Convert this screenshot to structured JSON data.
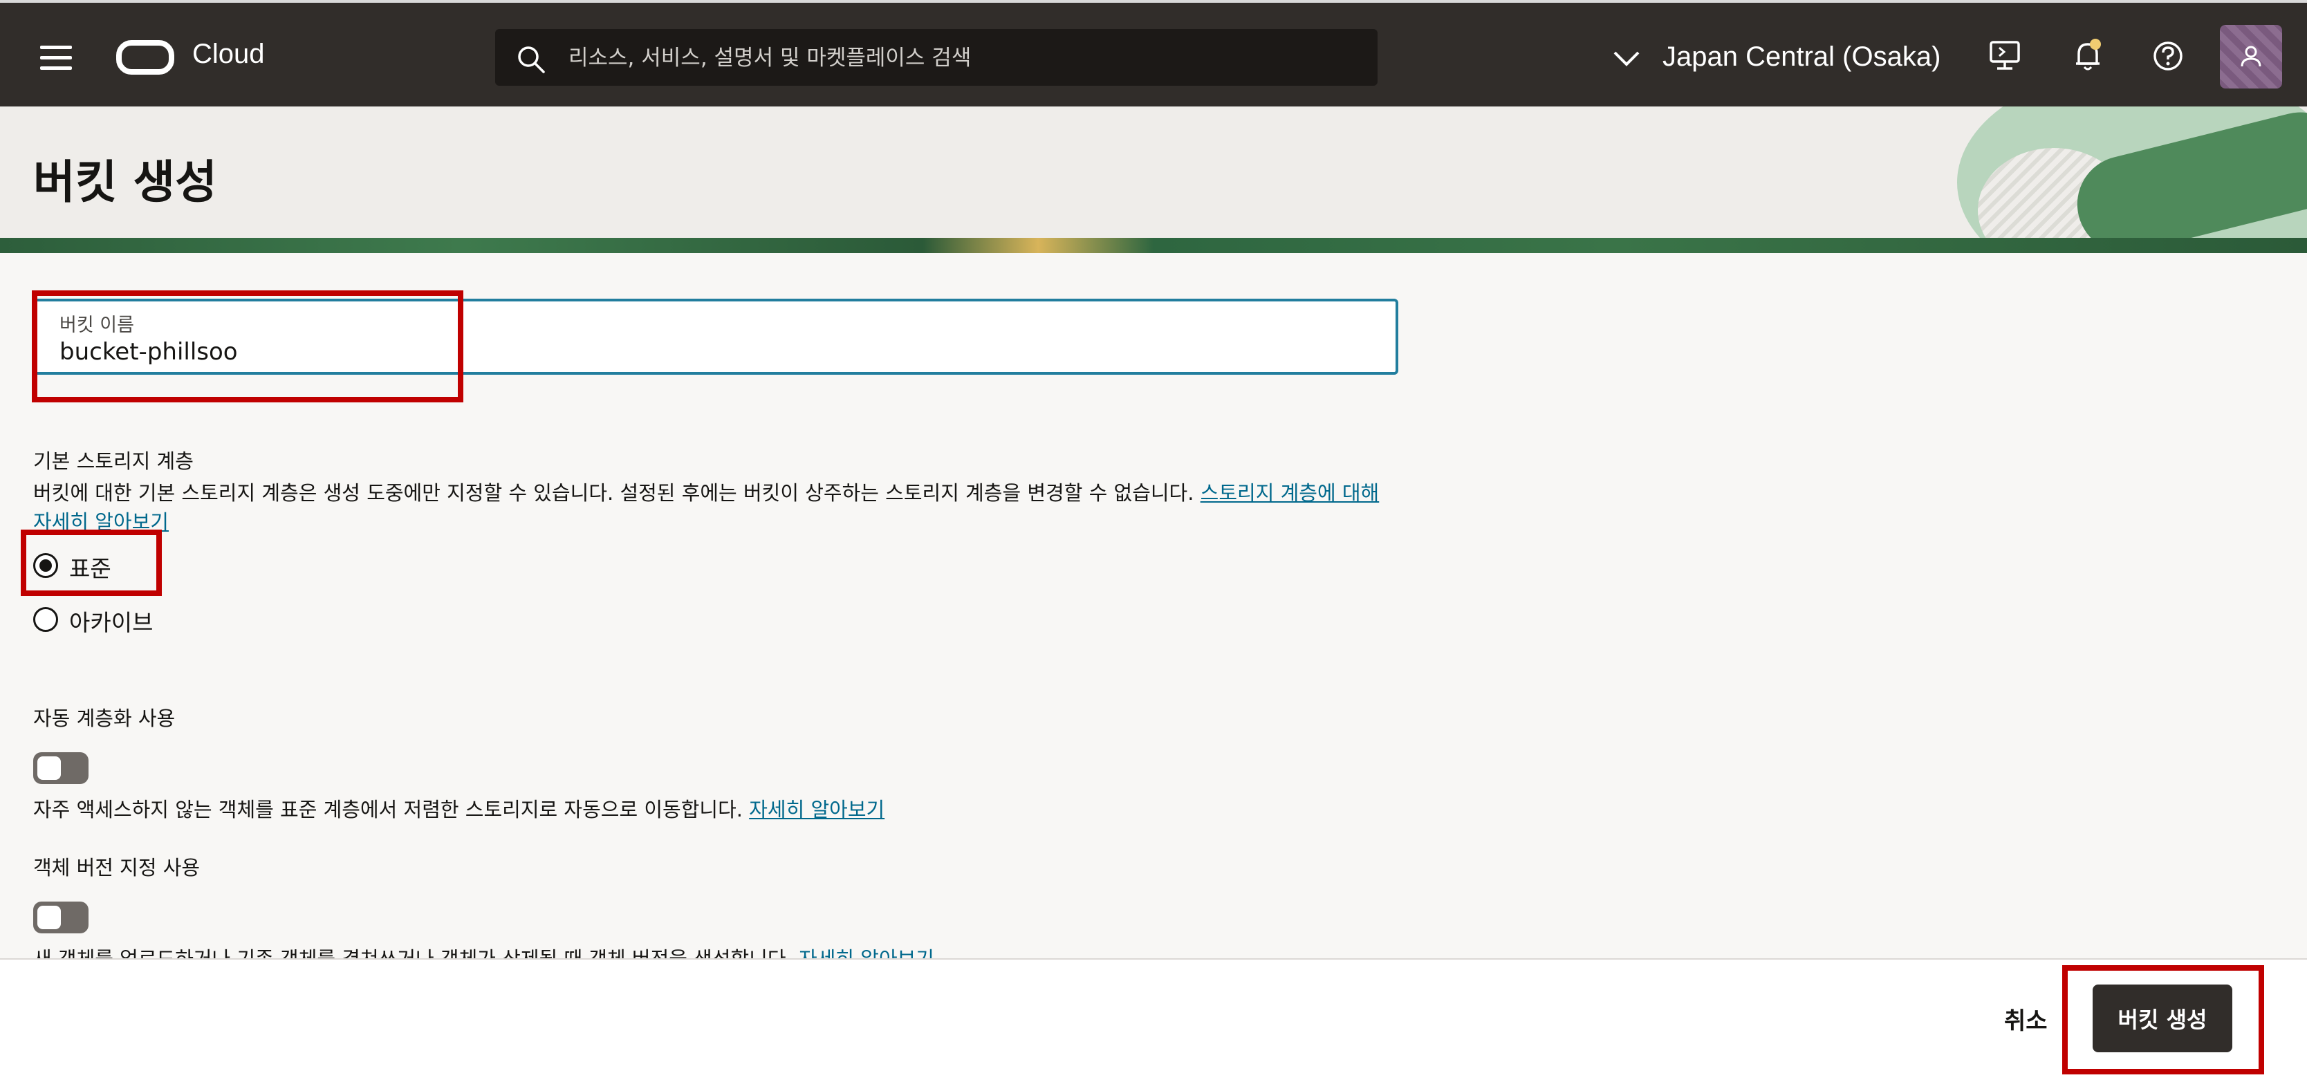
{
  "topbar": {
    "brand": "Cloud",
    "search_placeholder": "리소스, 서비스, 설명서 및 마켓플레이스 검색",
    "region": "Japan Central (Osaka)"
  },
  "page": {
    "title": "버킷 생성"
  },
  "form": {
    "bucket_name": {
      "label": "버킷 이름",
      "value": "bucket-phillsoo"
    },
    "storage_tier": {
      "label": "기본 스토리지 계층",
      "description": "버킷에 대한 기본 스토리지 계층은 생성 도중에만 지정할 수 있습니다. 설정된 후에는 버킷이 상주하는 스토리지 계층을 변경할 수 없습니다. ",
      "link": "스토리지 계층에 대해 자세히 알아보기",
      "options": [
        {
          "label": "표준",
          "checked": true
        },
        {
          "label": "아카이브",
          "checked": false
        }
      ]
    },
    "auto_tiering": {
      "label": "자동 계층화 사용",
      "enabled": false,
      "description": "자주 액세스하지 않는 객체를 표준 계층에서 저렴한 스토리지로 자동으로 이동합니다. ",
      "link": "자세히 알아보기"
    },
    "versioning": {
      "label": "객체 버전 지정 사용",
      "enabled": false,
      "description": "새 객체를 업로드하거나 기존 객체를 겹쳐쓰거나 객체가 삭제될 때 객체 버전을 생성합니다. ",
      "link": "자세히 알아보기"
    }
  },
  "footer": {
    "cancel_label": "취소",
    "create_label": "버킷 생성"
  },
  "colors": {
    "topbar": "#312d2a",
    "highlight": "#c00000",
    "link": "#00688c",
    "focus_border": "#227e9e"
  }
}
